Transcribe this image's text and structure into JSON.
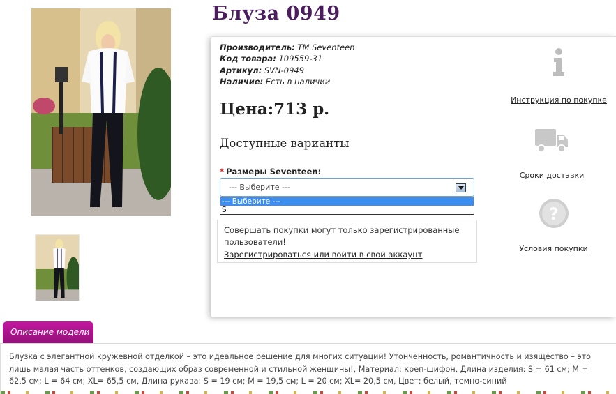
{
  "product": {
    "title": "Блуза 0949",
    "specs": [
      {
        "label": "Производитель:",
        "value": "ТМ Seventeen"
      },
      {
        "label": "Код товара:",
        "value": "109559-31"
      },
      {
        "label": "Артикул:",
        "value": "SVN-0949"
      },
      {
        "label": "Наличие:",
        "value": "Есть в наличии"
      }
    ],
    "price": "Цена:713 р."
  },
  "variants": {
    "heading": "Доступные варианты",
    "required_mark": "*",
    "size_label": "Размеры Seventeen:",
    "select_value": "--- Выберите ---",
    "options": [
      "--- Выберите ---",
      "S"
    ]
  },
  "notice": {
    "text": "Совершать покупки могут только зарегистрированные пользователи!",
    "link": "Зарегистрироваться или войти в свой аккаунт"
  },
  "side_links": {
    "instructions": "Инструкция по покупке",
    "delivery": "Сроки доставки",
    "conditions": "Условия покупки"
  },
  "description": {
    "tab_label": "Описание модели",
    "text": "Блузка с элегантной кружевной отделкой – это идеальное решение для многих ситуаций! Утонченность, романтичность и изящество – это лишь малая часть оттенков, создающих образ современной и стильной женщины!, Материал: креп-шифон, Длина изделия: S = 61 см; M = 62,5 см; L = 64 см; XL= 65,5 см, Длина рукава: S = 19 см; M = 19,5 см; L = 20 см; XL= 20,5 см, Цвет: белый, темно-синий"
  },
  "colors": {
    "title": "#4b1d5e",
    "tab": "#b0148e",
    "select_highlight": "#3b8ef0"
  }
}
